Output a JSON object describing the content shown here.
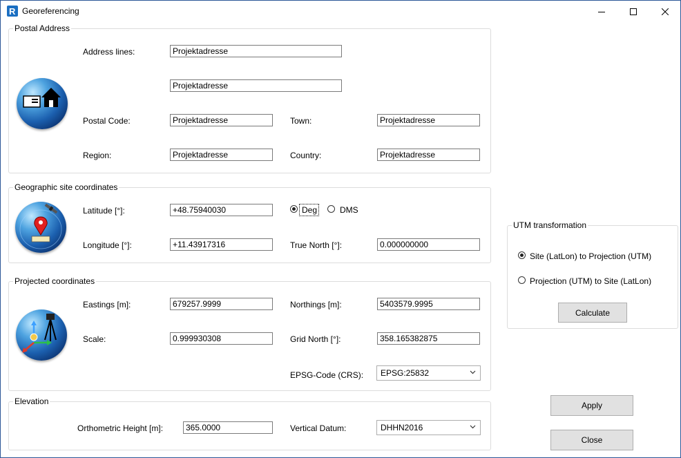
{
  "window": {
    "title": "Georeferencing"
  },
  "postal": {
    "group_title": "Postal Address",
    "address_label": "Address lines:",
    "address1": "Projektadresse",
    "address2": "Projektadresse",
    "postal_code_label": "Postal Code:",
    "postal_code": "Projektadresse",
    "town_label": "Town:",
    "town": "Projektadresse",
    "region_label": "Region:",
    "region": "Projektadresse",
    "country_label": "Country:",
    "country": "Projektadresse"
  },
  "geo": {
    "group_title": "Geographic site coordinates",
    "latitude_label": "Latitude [°]:",
    "latitude": "+48.75940030",
    "longitude_label": "Longitude [°]:",
    "longitude": "+11.43917316",
    "deg_label": "Deg",
    "dms_label": "DMS",
    "format_selected": "Deg",
    "true_north_label": "True North [°]:",
    "true_north": "0.000000000"
  },
  "projected": {
    "group_title": "Projected coordinates",
    "eastings_label": "Eastings [m]:",
    "eastings": "679257.9999",
    "northings_label": "Northings [m]:",
    "northings": "5403579.9995",
    "scale_label": "Scale:",
    "scale": "0.999930308",
    "grid_north_label": "Grid North [°]:",
    "grid_north": "358.165382875",
    "epsg_label": "EPSG-Code (CRS):",
    "epsg": "EPSG:25832"
  },
  "elevation": {
    "group_title": "Elevation",
    "height_label": "Orthometric Height [m]:",
    "height": "365.0000",
    "datum_label": "Vertical Datum:",
    "datum": "DHHN2016"
  },
  "utm": {
    "group_title": "UTM transformation",
    "option1": "Site (LatLon) to Projection (UTM)",
    "option2": "Projection (UTM) to Site (LatLon)",
    "selected": "option1",
    "calculate": "Calculate"
  },
  "buttons": {
    "apply": "Apply",
    "close": "Close"
  },
  "icons": {
    "app": "revit-r-icon",
    "postal": "postal-globe-icon",
    "geo": "satellite-globe-icon",
    "projected": "survey-globe-icon"
  },
  "colors": {
    "border": "#2b5797",
    "button_bg": "#e1e1e1",
    "textbox_border": "#7a7a7a"
  }
}
